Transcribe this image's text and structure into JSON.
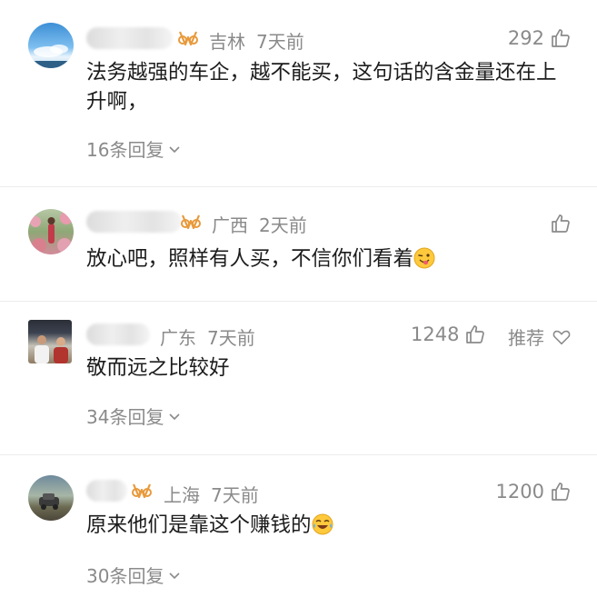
{
  "comments": [
    {
      "location": "吉林",
      "time": "7天前",
      "likes": "292",
      "text": "法务越强的车企，越不能买，这句话的含金量还在上升啊，",
      "replies": "16条回复"
    },
    {
      "location": "广西",
      "time": "2天前",
      "likes": "",
      "text": "放心吧，照样有人买，不信你们看着",
      "emoji": "wink-tongue-emoji",
      "replies": ""
    },
    {
      "location": "广东",
      "time": "7天前",
      "likes": "1248",
      "recommend": "推荐",
      "text": "敬而远之比较好",
      "replies": "34条回复"
    },
    {
      "location": "上海",
      "time": "7天前",
      "likes": "1200",
      "text": "原来他们是靠这个赚钱的",
      "emoji": "laugh-cry-emoji",
      "replies": "30条回复"
    }
  ],
  "colors": {
    "meta": "#8a8a8a",
    "text": "#1c1c1c",
    "vip": "#e89a3c"
  }
}
